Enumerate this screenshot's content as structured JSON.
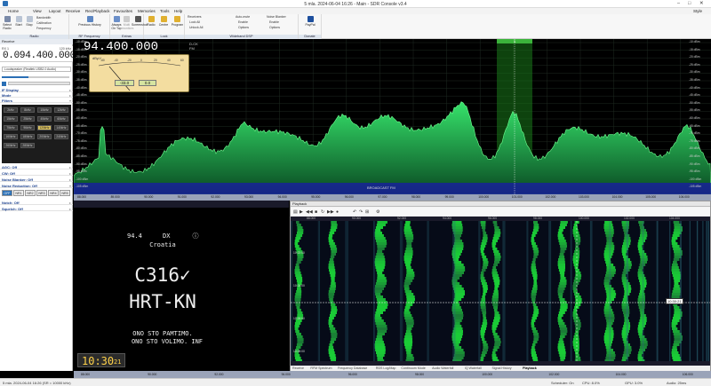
{
  "window": {
    "title": "5 mla. 2024-06-04 16:26 - Main - SDR Console v3.4"
  },
  "menu": [
    "Home",
    "View",
    "Layout",
    "Receive",
    "Rec/Playback",
    "Favourites",
    "Memories",
    "Tools",
    "Help"
  ],
  "menu_right": "Style",
  "ribbon": {
    "radio": {
      "group": "Radio",
      "select_radio": "Select Radio",
      "start": "Start",
      "stop": "Stop",
      "bandwidth": "Bandwidth",
      "calibration": "Calibration",
      "frequency": "Frequency"
    },
    "rf": {
      "group": "RF Frequency",
      "prev_history": "Previous History"
    },
    "extras": {
      "group": "Extras",
      "always_on_top": "Always On Top",
      "multi_monitor": "Multi monitors",
      "screenshot": "Screenshot"
    },
    "lock": {
      "group": "Lock",
      "radio": "Radio",
      "centre": "Centre",
      "program": "Program"
    },
    "receivers": {
      "group": "Receivers",
      "lock_all": "Lock All",
      "unlock_all": "Unlock All"
    },
    "wideband": {
      "group": "Wideband DSP",
      "auto_mute": "Auto-mute",
      "enable1": "Enable",
      "options1": "Options",
      "noise_blanker": "Noise Blanker",
      "enable2": "Enable",
      "options2": "Options"
    },
    "donate": {
      "group": "Donate",
      "paypal": "PayPal"
    }
  },
  "left": {
    "title": "Receive",
    "rx_label": "RX 1",
    "bw": "120 kHz",
    "frequency": "0.094.400.000",
    "audio": "Loudspeaker (Realtek USB2.0 Audio)",
    "sections": {
      "if_display": "IF Display",
      "mode": "Mode",
      "filters": "Filters",
      "agc": "AGC: Off",
      "cw": "CW: Off",
      "noise_blanker": "Noise Blanker: Off",
      "noise_reduction": "Noise Reduction: Off",
      "notch": "Notch: Off",
      "squelch": "Squelch: Off"
    },
    "filters": [
      "2kHz",
      "8kHz",
      "10kHz",
      "12kHz",
      "15kHz",
      "25kHz",
      "40kHz",
      "60kHz",
      "75kHz",
      "96kHz",
      "120kHz",
      "140kHz",
      "160kHz",
      "180kHz",
      "200kHz",
      "240kHz",
      "260kHz",
      "280kHz"
    ],
    "nr_buttons": [
      "OFF",
      "NR1",
      "NR2",
      "NR3",
      "NR4",
      "NR5"
    ]
  },
  "spectrum": {
    "frequency": "94.400.000",
    "mode": "FM",
    "hint": "D-CK",
    "meter": {
      "unit": "dBμV",
      "value1": "-33.0",
      "value2": "0.0",
      "scale": [
        "-60",
        "-40",
        "-20",
        "0",
        "20",
        "40",
        "60"
      ]
    },
    "db_labels": [
      "-10 dBm",
      "-15 dBm",
      "-20 dBm",
      "-25 dBm",
      "-30 dBm",
      "-35 dBm",
      "-40 dBm",
      "-45 dBm",
      "-50 dBm",
      "-55 dBm",
      "-60 dBm",
      "-65 dBm",
      "-70 dBm",
      "-75 dBm",
      "-80 dBm",
      "-85 dBm",
      "-90 dBm",
      "-95 dBm",
      "-100 dBm",
      "-105 dBm"
    ],
    "db_right": [
      "-10 dBm",
      "-15 dBm",
      "-20 dBm",
      "-25 dBm",
      "-30 dBm",
      "-35 dBm",
      "-40 dBm",
      "-45 dBm",
      "-50 dBm",
      "-55 dBm",
      "-60 dBm",
      "-65 dBm",
      "-70 dBm",
      "-75 dBm",
      "-80 dBm",
      "-85 dBm",
      "-90 dBm",
      "-95 dBm",
      "-100 dBm",
      "-105 dBm"
    ],
    "band_label": "BROADCAST FM",
    "freq_ticks": [
      "88.000",
      "89.000",
      "90.000",
      "91.000",
      "92.000",
      "93.000",
      "94.000",
      "95.000",
      "96.000",
      "97.000",
      "98.000",
      "99.000",
      "100.000",
      "101.000",
      "102.000",
      "103.000",
      "104.000",
      "105.000",
      "106.000"
    ],
    "marker": "1"
  },
  "rds": {
    "freq": "94.4",
    "dx": "DX",
    "country": "Croatia",
    "pi": "C316✓",
    "ps": "HRT-KN",
    "rt1": "ONO STO PAMTIMO.",
    "rt2": "ONO STO VOLIMO. INF",
    "time_hm": "10:30",
    "time_s": "21"
  },
  "playback": {
    "title": "Playback",
    "time_marker": "10:30:21",
    "times": [
      "10:22:00",
      "10:24:00",
      "10:26:00",
      "10:28:00"
    ],
    "freqs": [
      "88.000",
      "90.000",
      "92.000",
      "94.000",
      "96.000",
      "98.000",
      "100.000",
      "102.000",
      "104.000"
    ],
    "tabs": [
      "Receive",
      "RFM Spectrum",
      "Frequency Database",
      "RDS Log/Map",
      "Continuum Mode",
      "Audio Waterfall",
      "IQ Waterfall",
      "Signal History",
      "Playback"
    ]
  },
  "status": {
    "left": "5 mla. 2024-06-04 16:26 (SR = 10000 kHz)",
    "scheduler": "Scheduler: On",
    "cpu": "CPU: 8.0%",
    "gpu": "GPU: 3.0%",
    "audio": "Audio: 25ms"
  },
  "colors": {
    "accent": "#2a6fb5",
    "spectrum_green": "#1fd35a",
    "rds_time": "#ffd24a"
  }
}
